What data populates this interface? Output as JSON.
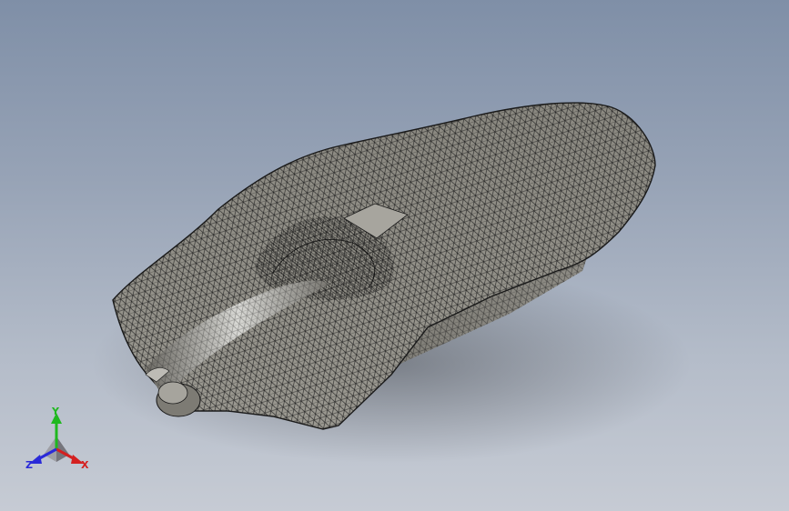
{
  "viewport": {
    "background_top": "#7f8fa7",
    "background_bottom": "#c6cbd4"
  },
  "model": {
    "display_mode": "shaded-with-mesh-edges",
    "fill_color": "#8d8b84",
    "mesh_color": "#1e1e1e"
  },
  "triad": {
    "x_label": "X",
    "y_label": "Y",
    "z_label": "Z",
    "x_color": "#d42020",
    "y_color": "#1fb81f",
    "z_color": "#2a2ad8"
  }
}
